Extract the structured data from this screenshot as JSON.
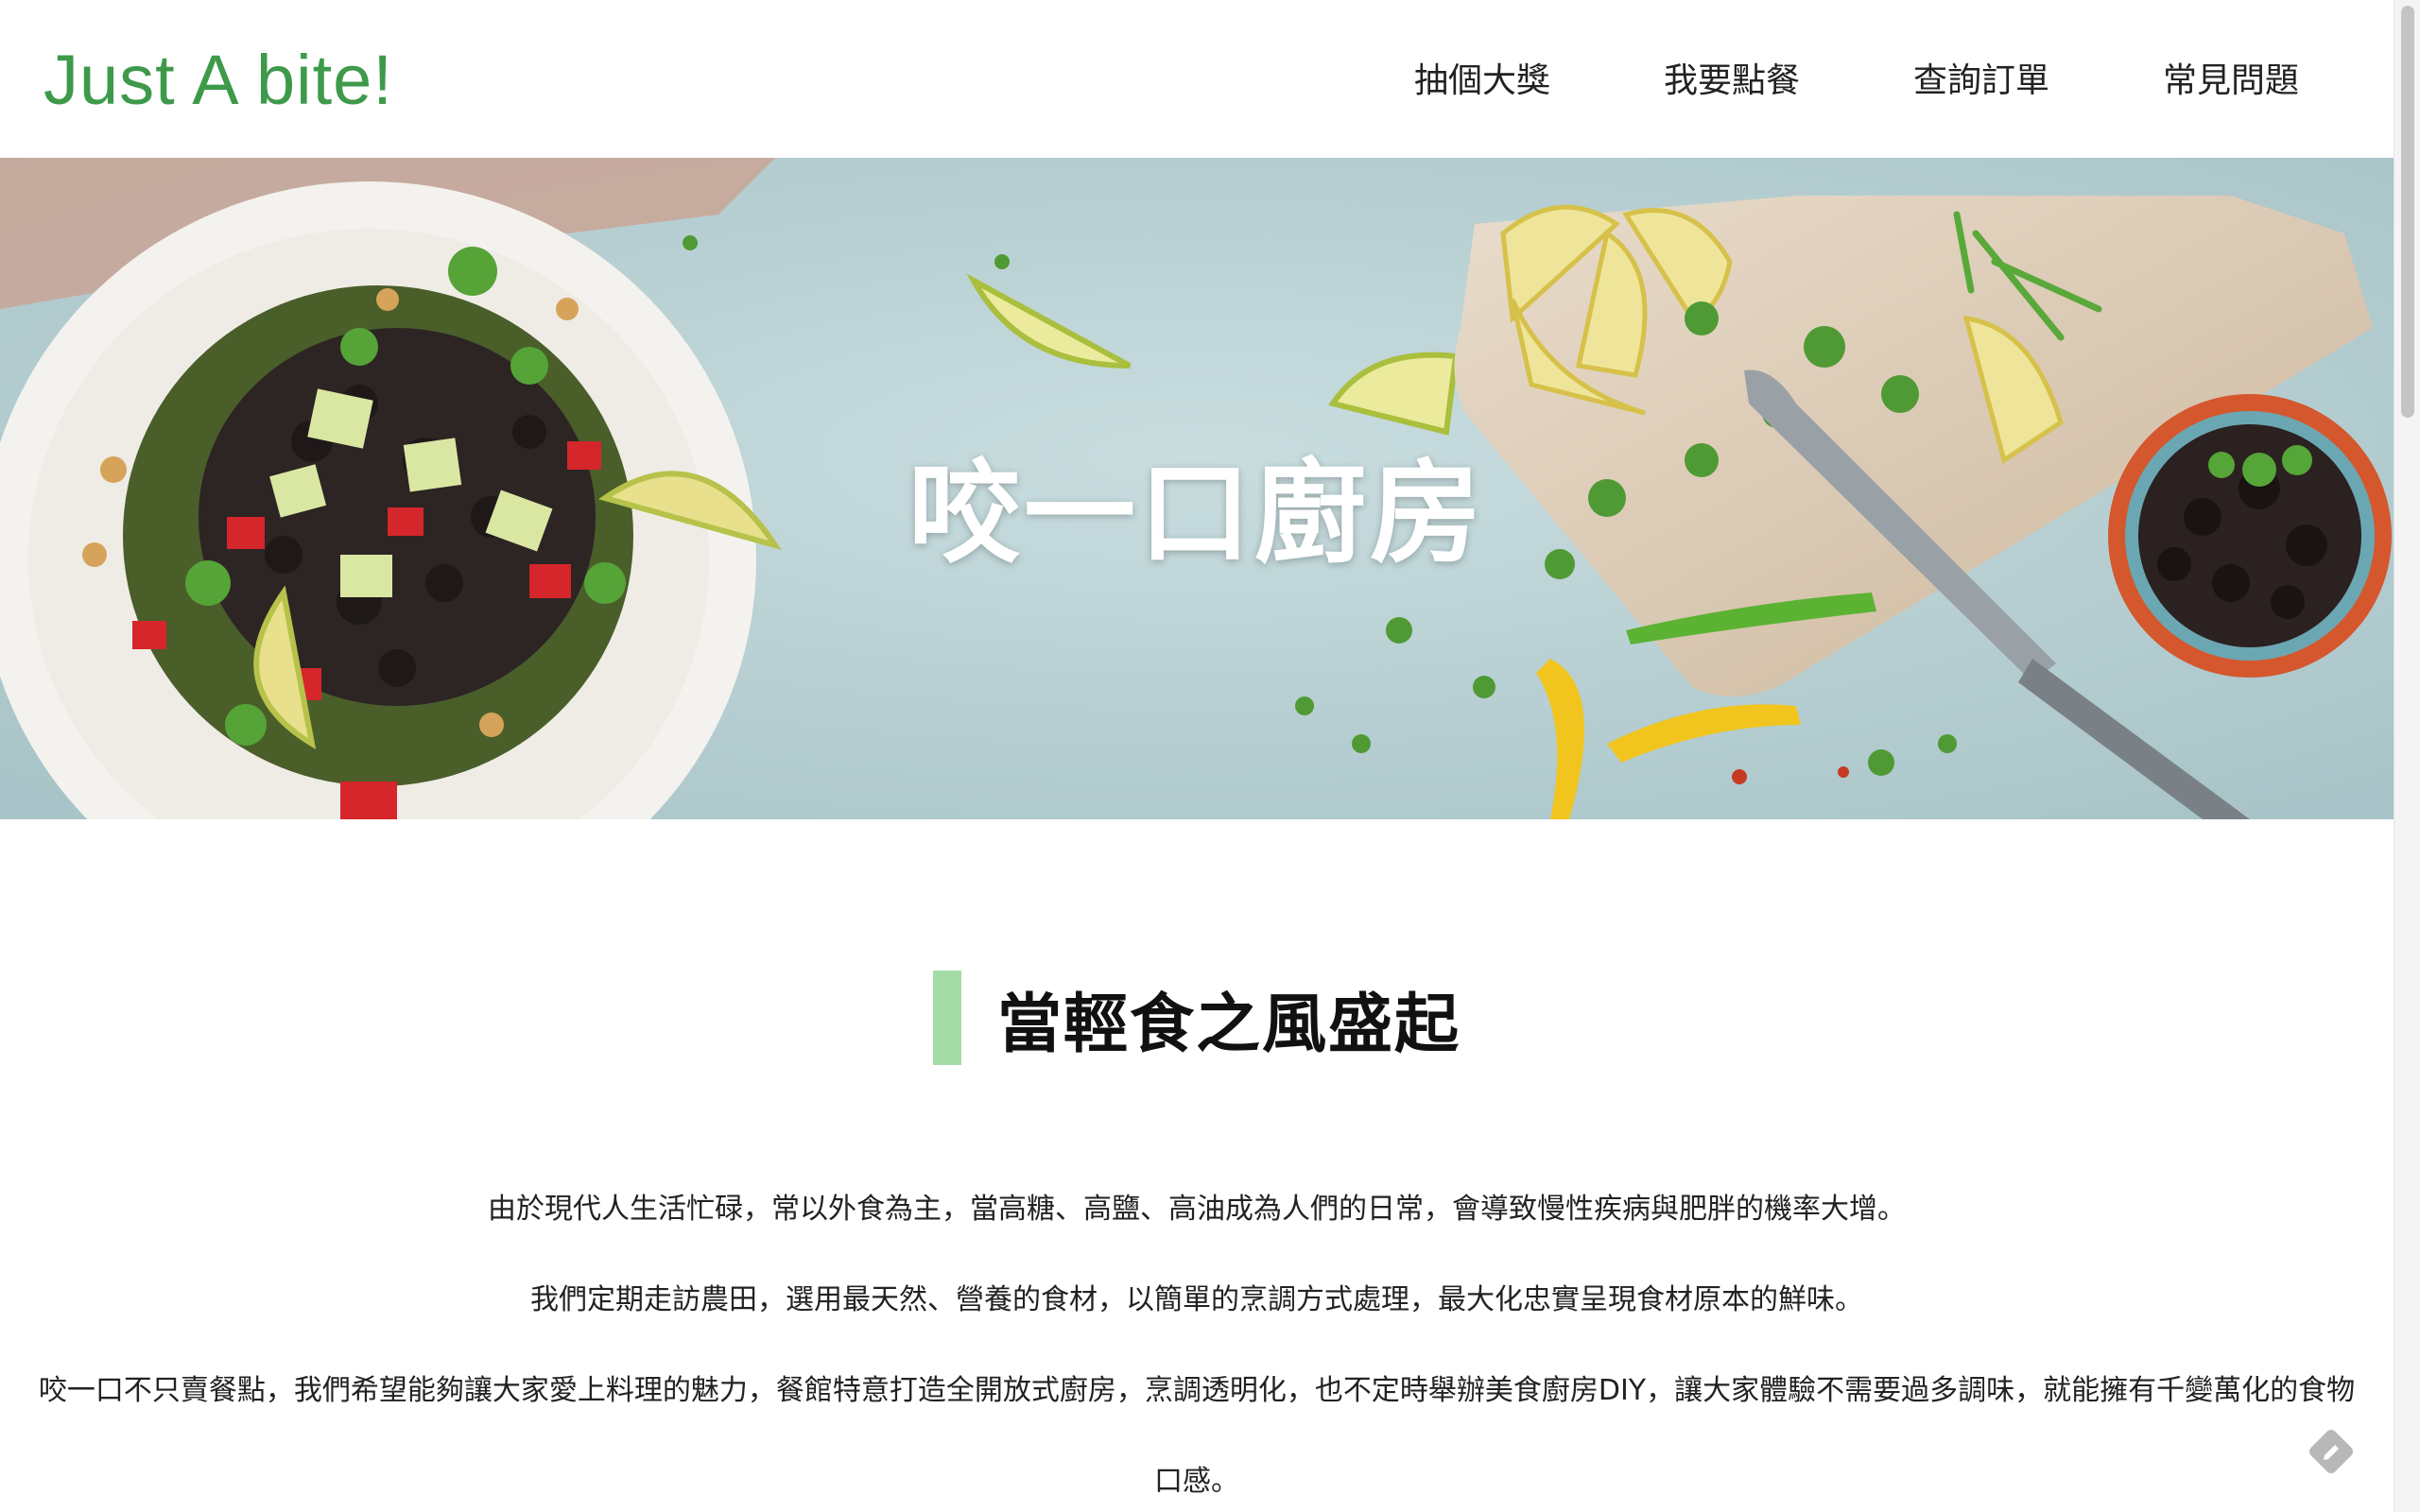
{
  "header": {
    "logo": "Just A bite!",
    "nav": [
      "抽個大獎",
      "我要點餐",
      "查詢訂單",
      "常見問題"
    ]
  },
  "hero": {
    "title": "咬一口廚房"
  },
  "intro": {
    "heading": "當輕食之風盛起",
    "paragraphs": [
      "由於現代人生活忙碌，常以外食為主，當高糖、高鹽、高油成為人們的日常，會導致慢性疾病與肥胖的機率大增。",
      "我們定期走訪農田，選用最天然、營養的食材，以簡單的烹調方式處理，最大化忠實呈現食材原本的鮮味。",
      "咬一口不只賣餐點，我們希望能夠讓大家愛上料理的魅力，餐館特意打造全開放式廚房，烹調透明化，也不定時舉辦美食廚房DIY，讓大家體驗不需要過多調味，就能擁有千變萬化的食物口感。"
    ]
  },
  "colors": {
    "brand_green": "#3e9a4a",
    "heading_accent": "#a3dca6",
    "hero_background": "#b9d2d5"
  },
  "icons": {
    "corner": "edit-icon"
  }
}
